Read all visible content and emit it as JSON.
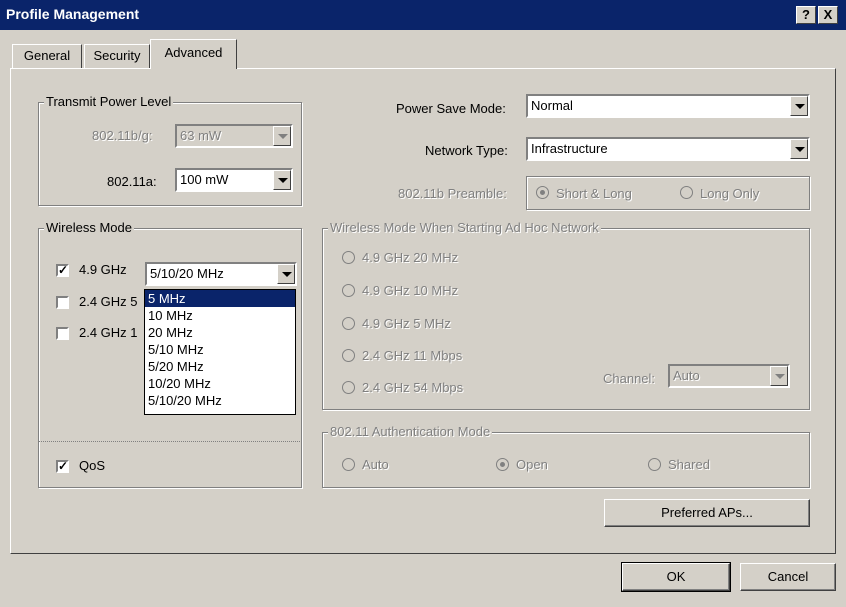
{
  "window": {
    "title": "Profile Management",
    "help_label": "?",
    "close_label": "X"
  },
  "tabs": [
    {
      "label": "General"
    },
    {
      "label": "Security"
    },
    {
      "label": "Advanced"
    }
  ],
  "transmit_power": {
    "legend": "Transmit Power Level",
    "b_g_label": "802.11b/g:",
    "b_g_value": "63 mW",
    "a_label": "802.11a:",
    "a_value": "100 mW"
  },
  "power_save": {
    "label": "Power Save Mode:",
    "value": "Normal"
  },
  "network_type": {
    "label": "Network Type:",
    "value": "Infrastructure"
  },
  "preamble": {
    "label": "802.11b Preamble:",
    "short_long": "Short & Long",
    "long_only": "Long Only"
  },
  "wireless_mode": {
    "legend": "Wireless Mode",
    "opt1": "4.9 GHz",
    "opt2": "2.4 GHz 5",
    "opt3": "2.4 GHz 1",
    "combo_value": "5/10/20 MHz",
    "dropdown": [
      "5 MHz",
      "10 MHz",
      "20 MHz",
      "5/10 MHz",
      "5/20 MHz",
      "10/20 MHz",
      "5/10/20 MHz"
    ],
    "qos": "QoS"
  },
  "adhoc": {
    "legend": "Wireless Mode When Starting Ad Hoc Network",
    "options": [
      "4.9 GHz 20 MHz",
      "4.9 GHz 10 MHz",
      "4.9 GHz 5 MHz",
      "2.4 GHz 11 Mbps",
      "2.4 GHz 54 Mbps"
    ],
    "channel_label": "Channel:",
    "channel_value": "Auto"
  },
  "auth": {
    "legend": "802.11 Authentication Mode",
    "auto": "Auto",
    "open": "Open",
    "shared": "Shared"
  },
  "buttons": {
    "preferred_aps": "Preferred APs...",
    "ok": "OK",
    "cancel": "Cancel"
  }
}
